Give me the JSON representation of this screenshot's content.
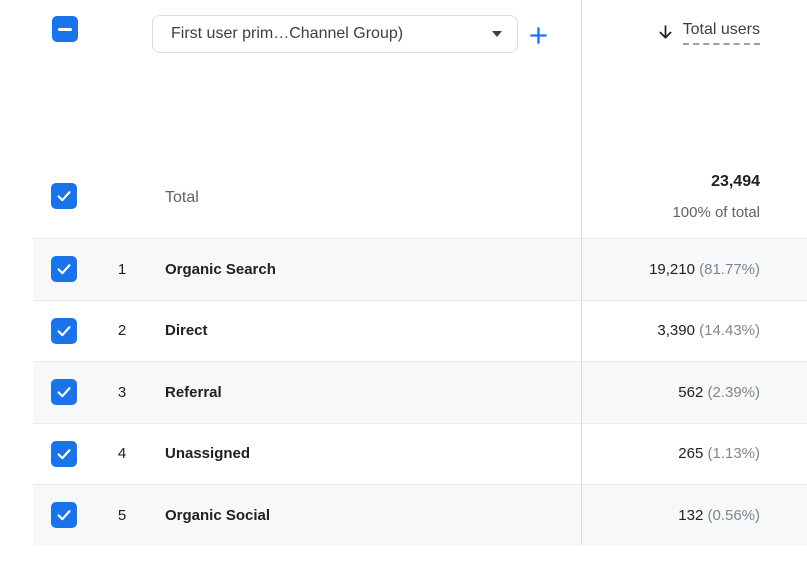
{
  "header": {
    "dimension_dropdown": {
      "value": "First user prim…Channel Group)"
    },
    "metric": {
      "label": "Total users",
      "sort_direction": "descending"
    }
  },
  "icons": {
    "select_all_checkbox": "indeterminate-checkbox",
    "row_checkbox": "checkmark",
    "dropdown_caret": "caret-down",
    "add_dimension": "plus",
    "sort": "arrow-down"
  },
  "colors": {
    "accent_blue": "#1a73e8",
    "text_primary": "#202124",
    "text_secondary": "#5f6368",
    "text_tertiary": "#80868b",
    "border": "#dadce0",
    "row_divider": "#e8eaed",
    "row_stripe": "#f6f8f9"
  },
  "totals": {
    "label": "Total",
    "users": "23,494",
    "share_of_total": "100% of total",
    "checked": true
  },
  "rows": [
    {
      "rank": "1",
      "channel": "Organic Search",
      "users": "19,210",
      "share": "(81.77%)",
      "checked": true
    },
    {
      "rank": "2",
      "channel": "Direct",
      "users": "3,390",
      "share": "(14.43%)",
      "checked": true
    },
    {
      "rank": "3",
      "channel": "Referral",
      "users": "562",
      "share": "(2.39%)",
      "checked": true
    },
    {
      "rank": "4",
      "channel": "Unassigned",
      "users": "265",
      "share": "(1.13%)",
      "checked": true
    },
    {
      "rank": "5",
      "channel": "Organic Social",
      "users": "132",
      "share": "(0.56%)",
      "checked": true
    }
  ]
}
